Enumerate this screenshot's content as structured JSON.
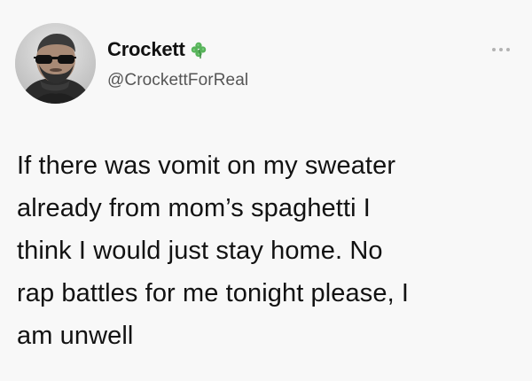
{
  "tweet": {
    "author": {
      "display_name": "Crockett",
      "badge_icon": "four-leaf-clover-icon",
      "badge_color": "#4caf50",
      "handle": "@CrockettForReal",
      "avatar": "profile-photo-man-sunglasses"
    },
    "more_icon": "more-horizontal-icon",
    "text_lines": [
      "If there was vomit on my sweater",
      "already from mom’s spaghetti I",
      "think I would just stay home. No",
      "rap battles for me tonight please, I",
      "am unwell"
    ]
  }
}
